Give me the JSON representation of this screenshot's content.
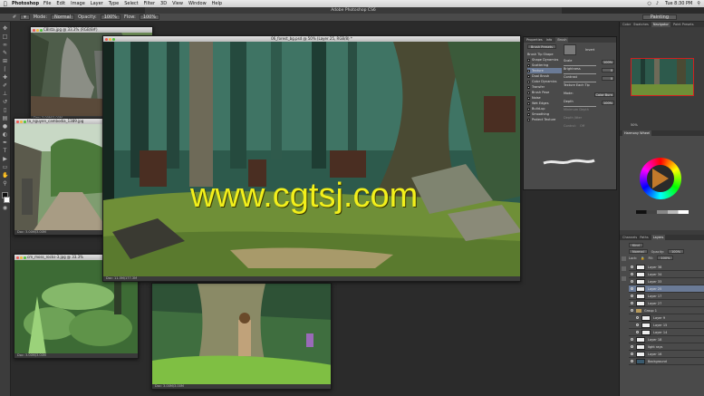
{
  "menubar": {
    "app_name": "Photoshop",
    "items": [
      "File",
      "Edit",
      "Image",
      "Layer",
      "Type",
      "Select",
      "Filter",
      "3D",
      "View",
      "Window",
      "Help"
    ],
    "clock": "Tue 8:30 PM"
  },
  "app_title": "Adobe Photoshop CS6",
  "options": {
    "mode_label": "Mode:",
    "mode_value": "Normal",
    "opacity_label": "Opacity:",
    "opacity_value": "100%",
    "flow_label": "Flow:",
    "flow_value": "100%",
    "workspace": "Painting"
  },
  "documents": {
    "ruins1": {
      "title": "C8lsta.jpg @ 33.3% (RGB/8#)",
      "status": "Doc: 3.00M/3.00M"
    },
    "ruins2": {
      "title": "ta_nguyen_cambodia_1389.jpg",
      "status": "Doc: 3.00M/3.00M"
    },
    "moss": {
      "title": "cm_moss_rocks-3.jpg @ 33.3%",
      "status": "Doc: 3.00M/3.00M"
    },
    "forest": {
      "title": "06_forest_bg.psd @ 50% (Layer 25, RGB/8) *",
      "status": "Doc: 11.5M/177.3M"
    },
    "tree": {
      "title": "",
      "status": "Doc: 3.00M/3.00M"
    }
  },
  "watermark": "www.cgtsj.com",
  "brush_panel": {
    "tabs": [
      "Properties",
      "Info",
      "Brush"
    ],
    "presets_button": "Brush Presets",
    "options": [
      "Brush Tip Shape",
      "Shape Dynamics",
      "Scattering",
      "Texture",
      "Dual Brush",
      "Color Dynamics",
      "Transfer",
      "Brush Pose",
      "Noise",
      "Wet Edges",
      "Build-up",
      "Smoothing",
      "Protect Texture"
    ],
    "selected_option": "Texture",
    "invert_label": "Invert",
    "scale_label": "Scale",
    "scale_value": "100%",
    "brightness_label": "Brightness",
    "brightness_value": "0",
    "contrast_label": "Contrast",
    "contrast_value": "0",
    "texture_each_tip": "Texture Each Tip",
    "mode_label": "Mode:",
    "mode_value": "Color Burn",
    "depth_label": "Depth",
    "depth_value": "100%",
    "min_depth_label": "Minimum Depth",
    "depth_jitter_label": "Depth Jitter",
    "control_label": "Control:",
    "control_value": "Off"
  },
  "right_dock": {
    "nav_tabs": [
      "Color",
      "Swatches",
      "Navigator",
      "Paint Presets"
    ],
    "nav_active": "Navigator",
    "nav_zoom": "50%",
    "color_tabs": [
      "Harmony Wheel"
    ],
    "layer_tabs": [
      "Channels",
      "Paths",
      "Layers"
    ],
    "layers_active": "Layers",
    "kind_label": "Kind",
    "blend_mode": "Normal",
    "opacity_label": "Opacity:",
    "opacity_value": "100%",
    "lock_label": "Lock:",
    "fill_label": "Fill:",
    "fill_value": "100%",
    "layers": [
      {
        "name": "Layer 38",
        "type": "layer",
        "selected": false,
        "indent": false
      },
      {
        "name": "Layer 34",
        "type": "layer",
        "selected": false,
        "indent": false
      },
      {
        "name": "Layer 33",
        "type": "layer",
        "selected": false,
        "indent": false
      },
      {
        "name": "Layer 25",
        "type": "layer",
        "selected": true,
        "indent": false
      },
      {
        "name": "Layer 17",
        "type": "layer",
        "selected": false,
        "indent": false
      },
      {
        "name": "Layer 27",
        "type": "layer",
        "selected": false,
        "indent": false
      },
      {
        "name": "Group 1",
        "type": "group",
        "selected": false,
        "indent": false
      },
      {
        "name": "Layer 9",
        "type": "layer",
        "selected": false,
        "indent": true
      },
      {
        "name": "Layer 15",
        "type": "layer",
        "selected": false,
        "indent": true
      },
      {
        "name": "Layer 14",
        "type": "layer",
        "selected": false,
        "indent": true
      },
      {
        "name": "Layer 18",
        "type": "layer",
        "selected": false,
        "indent": false
      },
      {
        "name": "light rays",
        "type": "layer",
        "selected": false,
        "indent": false
      },
      {
        "name": "Layer 16",
        "type": "layer",
        "selected": false,
        "indent": false
      },
      {
        "name": "Background",
        "type": "background",
        "selected": false,
        "indent": false
      }
    ]
  }
}
